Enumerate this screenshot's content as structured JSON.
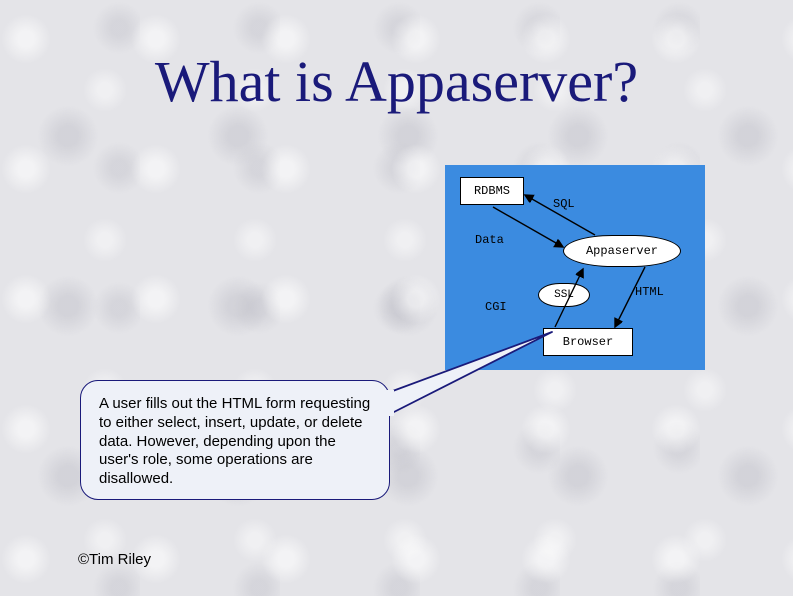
{
  "title": "What is Appaserver?",
  "diagram": {
    "rdbms": "RDBMS",
    "appaserver": "Appaserver",
    "browser": "Browser",
    "sql": "SQL",
    "data": "Data",
    "cgi": "CGI",
    "html": "HTML"
  },
  "callout": "A user fills out the HTML form requesting to either select, insert, update, or delete data. However, depending upon the user's role, some operations are disallowed.",
  "copyright": "©Tim Riley"
}
